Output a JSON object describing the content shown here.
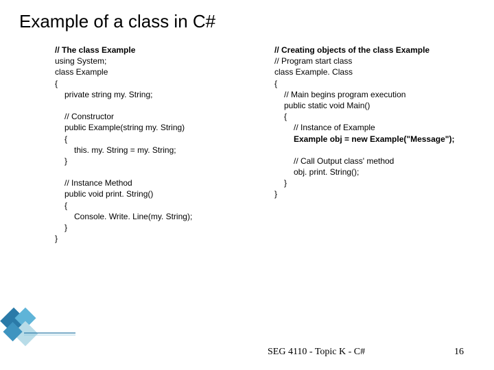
{
  "title": "Example of a class in C#",
  "left": {
    "h": "// The class Example",
    "l1": "using System;",
    "l2": "class Example",
    "l3": "{",
    "l4": "private string my. String;",
    "c1": "// Constructor",
    "c2": "public Example(string my. String)",
    "c3": "{",
    "c4": "this. my. String = my. String;",
    "c5": "}",
    "m1": "// Instance Method",
    "m2": "public void print. String()",
    "m3": "{",
    "m4": "Console. Write. Line(my. String);",
    "m5": "}",
    "l5": "}"
  },
  "right": {
    "h": "// Creating objects of the class Example",
    "l1": "// Program start class",
    "l2": "class Example. Class",
    "l3": "{",
    "m1": "// Main begins program execution",
    "m2": "public static void Main()",
    "m3": "{",
    "i1": "// Instance of Example",
    "i2": "Example obj = new Example(\"Message\");",
    "c1": "// Call Output class' method",
    "c2": "obj. print. String();",
    "m4": "}",
    "l4": "}"
  },
  "footer": {
    "text": "SEG 4110 - Topic K - C#",
    "page": "16"
  }
}
